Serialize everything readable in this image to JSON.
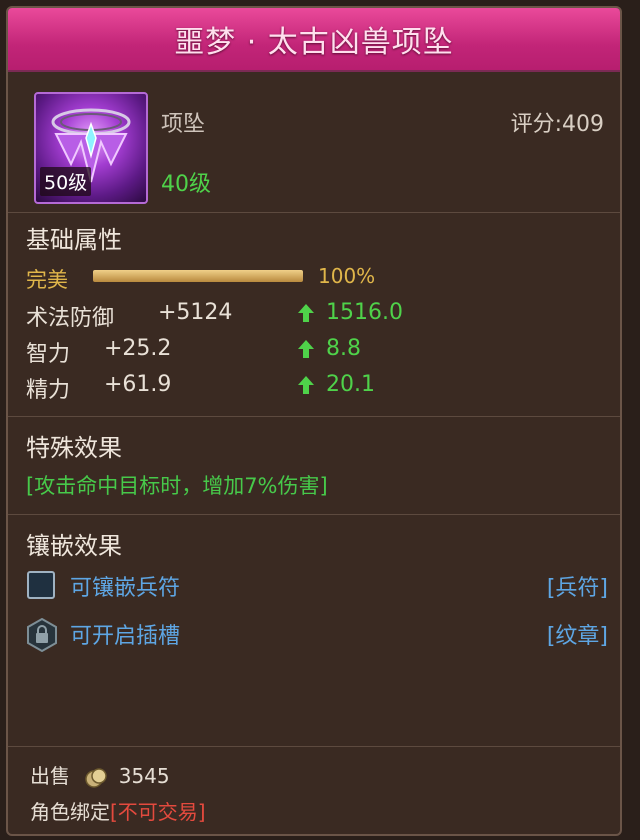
{
  "title": "噩梦 · 太古凶兽项坠",
  "item": {
    "type": "项坠",
    "score_label": "评分:409",
    "level_badge": "50级",
    "required_level": "40级"
  },
  "base": {
    "section_title": "基础属性",
    "perfect_label": "完美",
    "perfect_value": "100%",
    "perfect_fraction": 1.0,
    "stats": [
      {
        "name": "术法防御",
        "value": "+5124",
        "gain": "1516.0"
      },
      {
        "name": "智力",
        "value": "+25.2",
        "gain": "8.8"
      },
      {
        "name": "精力",
        "value": "+61.9",
        "gain": "20.1"
      }
    ]
  },
  "special": {
    "section_title": "特殊效果",
    "text": "[攻击命中目标时，增加7%伤害]"
  },
  "socket": {
    "section_title": "镶嵌效果",
    "rows": [
      {
        "label": "可镶嵌兵符",
        "tag": "[兵符]",
        "icon": "empty-socket-icon"
      },
      {
        "label": "可开启插槽",
        "tag": "[纹章]",
        "icon": "locked-slot-icon"
      }
    ]
  },
  "footer": {
    "sell_label": "出售",
    "sell_price": "3545",
    "bind_label": "角色绑定",
    "bind_status": "[不可交易]"
  },
  "colors": {
    "title_bar": "#c22578",
    "green": "#4fd24a",
    "gold": "#e0b64a",
    "blue_link": "#5ea6e4",
    "red": "#e44a3e"
  }
}
